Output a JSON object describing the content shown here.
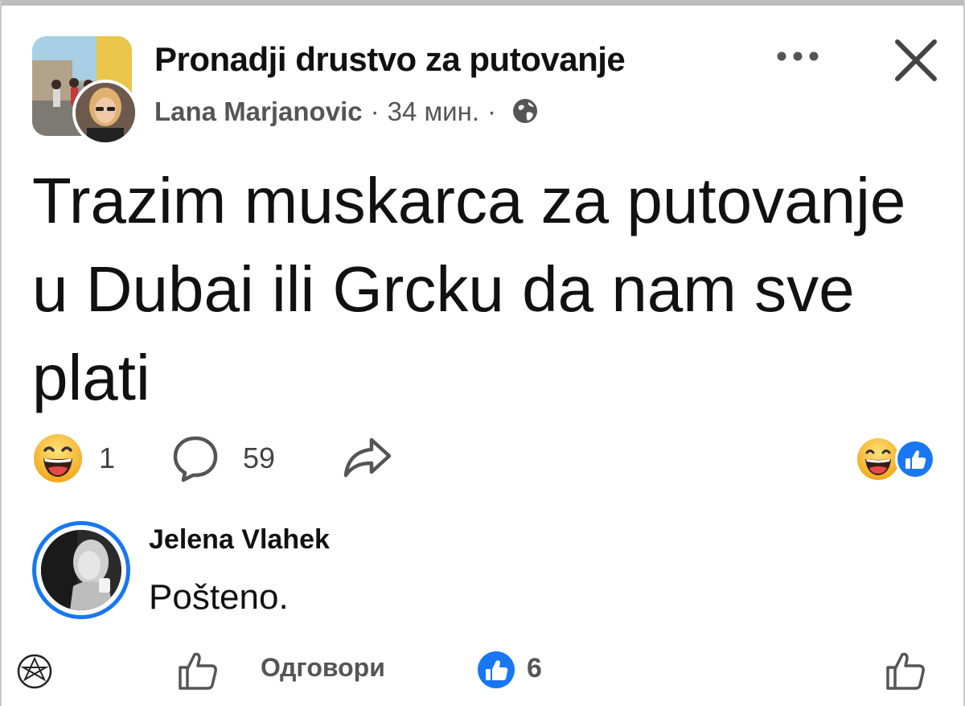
{
  "post": {
    "group_name": "Pronadji drustvo za putovanje",
    "author": "Lana Marjanovic",
    "separator": "·",
    "time": "34 мин.",
    "text": "Trazim muskarca za putovanje u Dubai ili Grcku da nam sve plati",
    "more_icon": "more-dots-icon",
    "close_icon": "close-icon",
    "privacy_icon": "globe-icon"
  },
  "reactions": {
    "laugh_count": "1",
    "comment_count": "59",
    "emoji": "laugh-emoji-icon",
    "comment_icon": "comment-bubble-icon",
    "share_icon": "share-arrow-icon"
  },
  "comment": {
    "author": "Jelena Vlahek",
    "text": "Pošteno.",
    "reply_label": "Одговори",
    "like_count": "6"
  },
  "colors": {
    "accent_blue": "#1877f2",
    "emoji_yellow": "#f7c544",
    "text_primary": "#111111",
    "text_secondary": "#555555"
  }
}
